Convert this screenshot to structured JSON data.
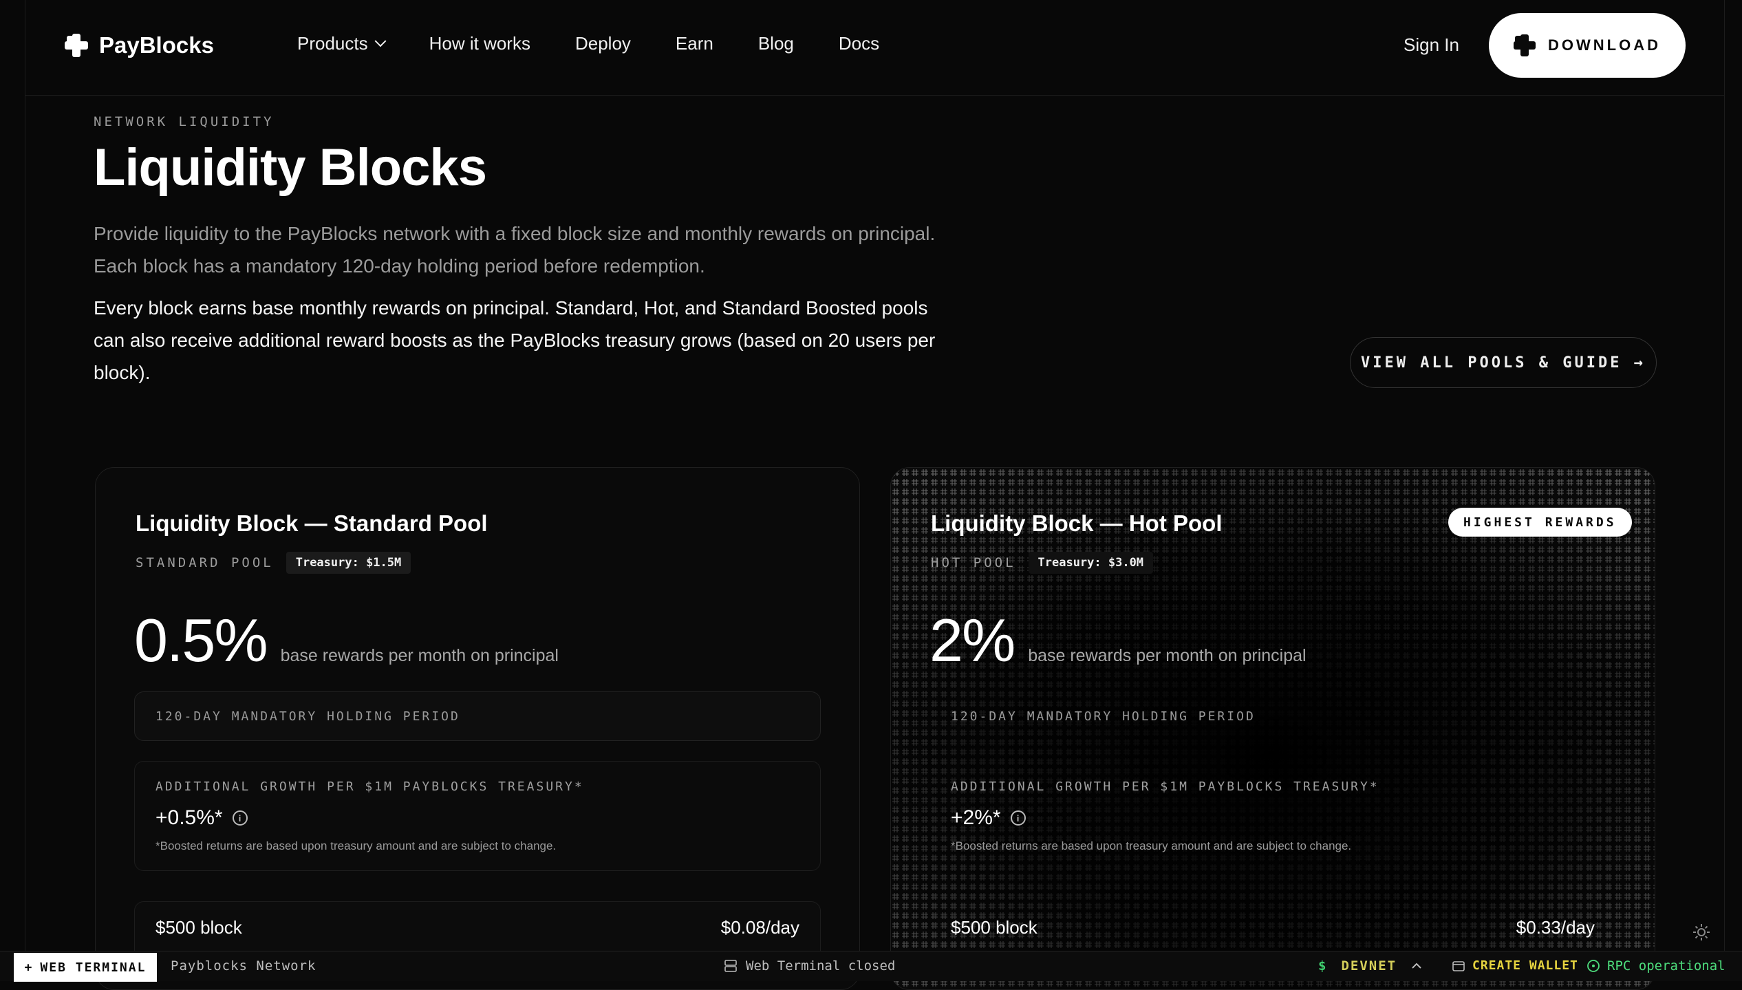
{
  "nav": {
    "brand": "PayBlocks",
    "links": [
      "Products",
      "How it works",
      "Deploy",
      "Earn",
      "Blog",
      "Docs"
    ],
    "signin": "Sign In",
    "download": "DOWNLOAD"
  },
  "hero": {
    "eyebrow": "NETWORK LIQUIDITY",
    "title": "Liquidity Blocks",
    "lead": "Provide liquidity to the PayBlocks network with a fixed block size and monthly rewards on principal. Each block has a mandatory 120-day holding period before redemption.",
    "lead2": "Every block earns base monthly rewards on principal. Standard, Hot, and Standard Boosted pools can also receive additional reward boosts as the PayBlocks treasury grows (based on 20 users per block).",
    "cta": "VIEW ALL POOLS & GUIDE →"
  },
  "cards": [
    {
      "title": "Liquidity Block — Standard Pool",
      "pool": "STANDARD POOL",
      "treasury": "Treasury: $1.5M",
      "rate": "0.5%",
      "rate_desc": "base rewards per month on principal",
      "hold": "120-DAY MANDATORY HOLDING PERIOD",
      "boost_label": "ADDITIONAL GROWTH PER $1M PAYBLOCKS TREASURY*",
      "boost_value": "+0.5%*",
      "boost_note": "*Boosted returns are based upon treasury amount and are subject to change.",
      "block": "$500 block",
      "per_day": "$0.08/day"
    },
    {
      "title": "Liquidity Block — Hot Pool",
      "badge": "HIGHEST REWARDS",
      "pool": "HOT POOL",
      "treasury": "Treasury: $3.0M",
      "rate": "2%",
      "rate_desc": "base rewards per month on principal",
      "hold": "120-DAY MANDATORY HOLDING PERIOD",
      "boost_label": "ADDITIONAL GROWTH PER $1M PAYBLOCKS TREASURY*",
      "boost_value": "+2%*",
      "boost_note": "*Boosted returns are based upon treasury amount and are subject to change.",
      "block": "$500 block",
      "per_day": "$0.33/day"
    }
  ],
  "statusbar": {
    "terminal_btn": "WEB TERMINAL",
    "network": "Payblocks Network",
    "terminal_status": "Web Terminal closed",
    "devnet": "DEVNET",
    "devnet_symbol": "$",
    "create_wallet": "CREATE WALLET",
    "rpc": "RPC operational"
  },
  "icons": {
    "logo": "payblocks-logo-icon",
    "chevron": "chevron-down-icon",
    "info": "info-icon",
    "plus": "plus-icon",
    "terminal": "server-icon",
    "wallet": "wallet-icon",
    "status": "check-circle-icon",
    "theme": "sun-icon"
  },
  "colors": {
    "background": "#080808",
    "accent_yellow": "#e6d43f",
    "accent_green": "#4ddc7c"
  }
}
